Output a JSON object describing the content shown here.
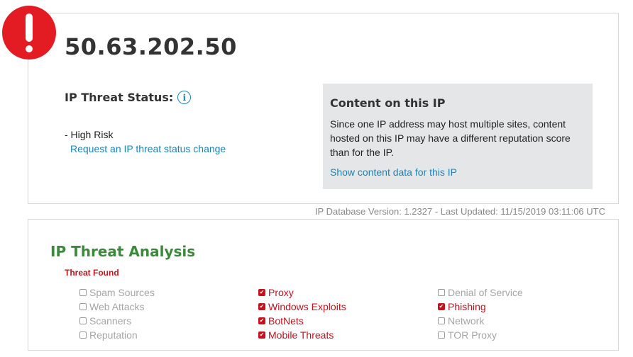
{
  "ip_card": {
    "ip_address": "50.63.202.50",
    "threat_status_label": "IP Threat Status:",
    "info_icon": "i",
    "risk_level": "- High Risk",
    "request_change_link": "Request an IP threat status change"
  },
  "content_box": {
    "title": "Content on this IP",
    "description": "Since one IP address may host multiple sites, content hosted on this IP may have a different reputation score than for the IP.",
    "link": "Show content data for this IP"
  },
  "db_version": "IP Database Version: 1.2327 - Last Updated: 11/15/2019 03:11:06 UTC",
  "analysis": {
    "title": "IP Threat Analysis",
    "threat_found_label": "Threat Found",
    "columns": [
      [
        {
          "label": "Spam Sources",
          "checked": false
        },
        {
          "label": "Web Attacks",
          "checked": false
        },
        {
          "label": "Scanners",
          "checked": false
        },
        {
          "label": "Reputation",
          "checked": false
        }
      ],
      [
        {
          "label": "Proxy",
          "checked": true
        },
        {
          "label": "Windows Exploits",
          "checked": true
        },
        {
          "label": "BotNets",
          "checked": true
        },
        {
          "label": "Mobile Threats",
          "checked": true
        }
      ],
      [
        {
          "label": "Denial of Service",
          "checked": false
        },
        {
          "label": "Phishing",
          "checked": true
        },
        {
          "label": "Network",
          "checked": false
        },
        {
          "label": "TOR Proxy",
          "checked": false
        }
      ]
    ]
  },
  "colors": {
    "alert_red": "#e31b23",
    "link_blue": "#1a84b8",
    "analysis_green": "#3a8a3a",
    "threat_red": "#c8101a"
  },
  "icons": {
    "alert": "exclamation-circle-icon",
    "info": "info-circle-icon",
    "checked": "checked-checkbox-icon",
    "unchecked": "unchecked-checkbox-icon"
  }
}
